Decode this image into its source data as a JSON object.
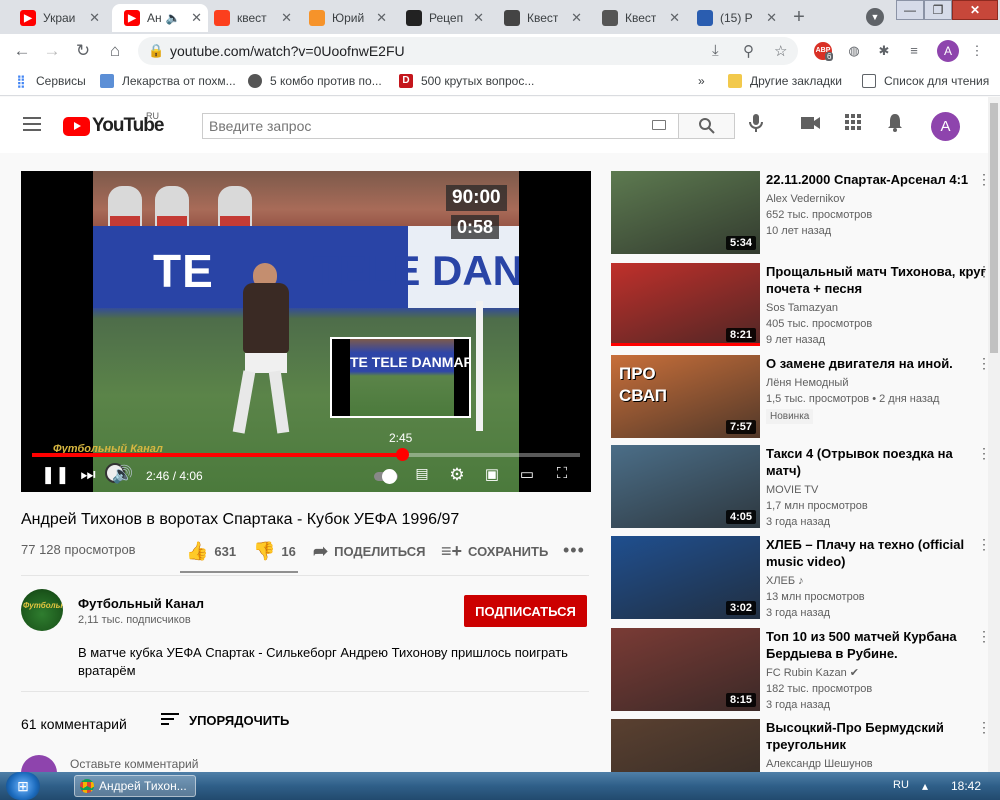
{
  "browser": {
    "tabs": [
      {
        "title": "Украи",
        "icon": "youtube-icon",
        "color": "#ff0000",
        "active": false
      },
      {
        "title": "Ан",
        "icon": "youtube-icon",
        "color": "#ff0000",
        "active": true,
        "muted_icon": "speaker-icon"
      },
      {
        "title": "квест",
        "icon": "yandex-icon",
        "color": "#fc3f1d",
        "active": false
      },
      {
        "title": "Юрий",
        "icon": "tab-site-icon",
        "color": "#f6932a",
        "active": false
      },
      {
        "title": "Рецеп",
        "icon": "tab-site-icon",
        "color": "#222222",
        "active": false
      },
      {
        "title": "Квест",
        "icon": "tab-site-icon",
        "color": "#444444",
        "active": false
      },
      {
        "title": "Квест",
        "icon": "tab-site-icon",
        "color": "#555555",
        "active": false
      },
      {
        "title": "(15) Р",
        "icon": "tab-site-icon",
        "color": "#2a5db0",
        "active": false
      }
    ],
    "url": "youtube.com/watch?v=0UoofnwE2FU",
    "ext_badge_count": "6",
    "profile_initial": "A",
    "bookmarks": [
      {
        "label": "Сервисы",
        "icon": "apps-grid-icon"
      },
      {
        "label": "Лекарства от похм...",
        "icon": "bookmark-page-icon"
      },
      {
        "label": "5 комбо против по...",
        "icon": "globe-icon"
      },
      {
        "label": "500 крутых вопрос...",
        "icon": "d-site-icon"
      }
    ],
    "overflow": "»",
    "other_bookmarks": "Другие закладки",
    "reading_list": "Список для чтения"
  },
  "youtube": {
    "logo_text": "YouTube",
    "region": "RU",
    "search_placeholder": "Введите запрос",
    "avatar_initial": "A"
  },
  "player": {
    "score_time": "90:00",
    "score_time2": "0:58",
    "hover_time": "2:45",
    "current_time": "2:46 / 4:06",
    "progress_fraction": 0.675,
    "watermark_text": "Футбольный Канал"
  },
  "video": {
    "title": "Андрей Тихонов в воротах Спартака - Кубок УЕФА 1996/97",
    "views": "77 128 просмотров",
    "likes": "631",
    "dislikes": "16",
    "share_label": "ПОДЕЛИТЬСЯ",
    "save_label": "СОХРАНИТЬ",
    "more": "•••"
  },
  "channel": {
    "name": "Футбольный Канал",
    "subscribers": "2,11 тыс. подписчиков",
    "subscribe_label": "ПОДПИСАТЬСЯ",
    "description": "В матче кубка УЕФА Спартак - Силькеборг Андрею Тихонову пришлось поиграть вратарём"
  },
  "comments": {
    "count": "61 комментарий",
    "sort_label": "УПОРЯДОЧИТЬ",
    "input_placeholder": "Оставьте комментарий"
  },
  "related": [
    {
      "title": "22.11.2000 Спартак-Арсенал 4:1",
      "channel": "Alex Vedernikov",
      "views": "652 тыс. просмотров",
      "age": "10 лет назад",
      "duration": "5:34",
      "thumb": "#5d7a50",
      "watched": false,
      "verified": false,
      "new": false
    },
    {
      "title": "Прощальный матч Тихонова, круг почета + песня",
      "channel": "Sos Tamazyan",
      "views": "405 тыс. просмотров",
      "age": "9 лет назад",
      "duration": "8:21",
      "thumb": "#c0302b",
      "watched": true,
      "verified": false,
      "new": false
    },
    {
      "title": "О замене двигателя на иной.",
      "channel": "Лёня Немодный",
      "views": "1,5 тыс. просмотров",
      "age": "2 дня назад",
      "duration": "7:57",
      "thumb": "#c86f3a",
      "watched": false,
      "verified": false,
      "new": true,
      "new_label": "Новинка",
      "overlay": "ПРО СВАП"
    },
    {
      "title": "Такси 4 (Отрывок поездка на матч)",
      "channel": "MOVIE TV",
      "views": "1,7 млн просмотров",
      "age": "3 года назад",
      "duration": "4:05",
      "thumb": "#4b6e88",
      "watched": false,
      "verified": false,
      "new": false
    },
    {
      "title": "ХЛЕБ – Плачу на техно (official music video)",
      "channel": "ХЛЕБ",
      "views": "13 млн просмотров",
      "age": "3 года назад",
      "duration": "3:02",
      "thumb": "#1f4f8f",
      "watched": false,
      "verified": false,
      "music": true,
      "new": false
    },
    {
      "title": "Топ 10 из 500 матчей Курбана Бердыева в Рубине.",
      "channel": "FC Rubin Kazan",
      "views": "182 тыс. просмотров",
      "age": "3 года назад",
      "duration": "8:15",
      "thumb": "#7a3b35",
      "watched": false,
      "verified": true,
      "new": false
    },
    {
      "title": "Высоцкий-Про Бермудский треугольник",
      "channel": "Александр Шешунов",
      "views": "",
      "age": "",
      "duration": "",
      "thumb": "#5a4030",
      "watched": false,
      "verified": false,
      "new": false
    }
  ],
  "taskbar": {
    "window_title": "Андрей Тихон...",
    "lang": "RU",
    "clock": "18:42"
  }
}
